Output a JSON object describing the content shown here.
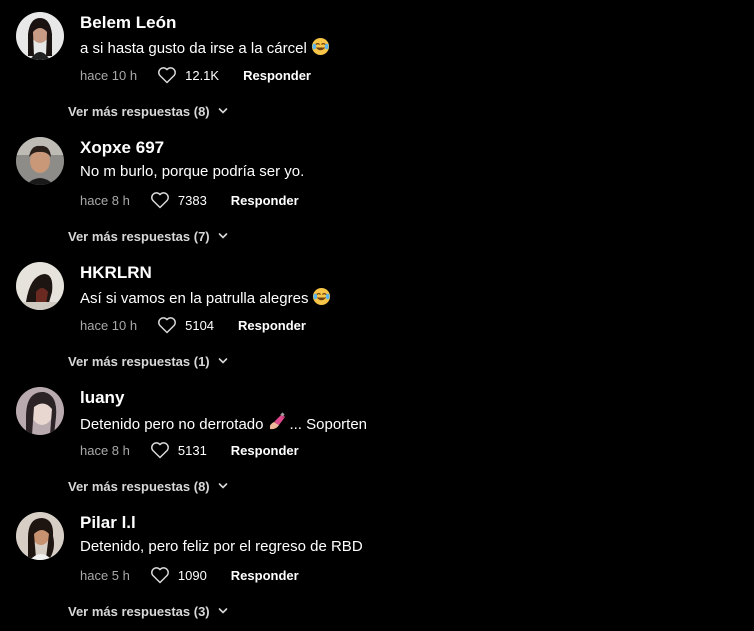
{
  "comments": [
    {
      "username": "Belem León",
      "text": "a si hasta gusto da irse a la cárcel",
      "emoji": "laughing-tears",
      "time": "hace 10 h",
      "likes": "12.1K",
      "reply_label": "Responder",
      "more_replies": "Ver más respuestas (8)"
    },
    {
      "username": "Xopxe 697",
      "text": "No m burlo, porque podría ser yo.",
      "emoji": "",
      "time": "hace 8 h",
      "likes": "7383",
      "reply_label": "Responder",
      "more_replies": "Ver más respuestas (7)"
    },
    {
      "username": "HKRLRN",
      "text": "Así si vamos en la patrulla alegres",
      "emoji": "laughing-tears",
      "time": "hace 10 h",
      "likes": "5104",
      "reply_label": "Responder",
      "more_replies": "Ver más respuestas (1)"
    },
    {
      "username": "luany",
      "text_before": "Detenido pero no derrotado",
      "text_after": "... Soporten",
      "emoji": "nail-polish",
      "time": "hace 8 h",
      "likes": "5131",
      "reply_label": "Responder",
      "more_replies": "Ver más respuestas (8)"
    },
    {
      "username": "Pilar l.l",
      "text": "Detenido, pero feliz por el regreso de RBD",
      "emoji": "",
      "time": "hace 5 h",
      "likes": "1090",
      "reply_label": "Responder",
      "more_replies": "Ver más respuestas (3)"
    }
  ],
  "colors": {
    "background": "#000000",
    "primary_text": "#ffffff",
    "secondary_text": "#a9a9a9"
  }
}
